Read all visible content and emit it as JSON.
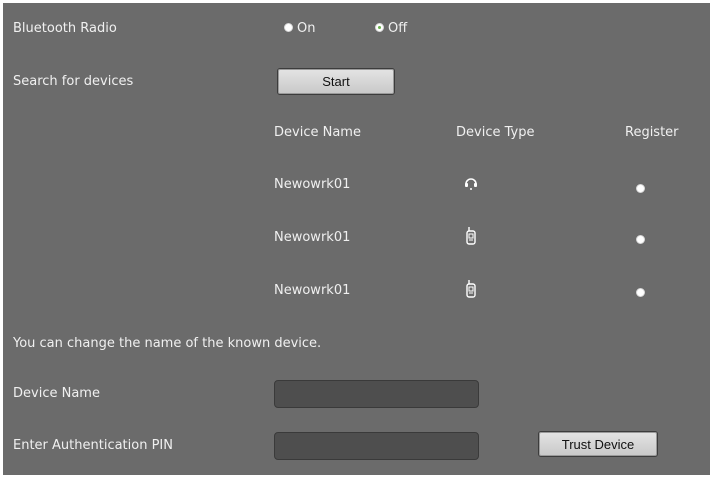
{
  "bluetooth": {
    "label": "Bluetooth Radio",
    "on_label": "On",
    "off_label": "Off",
    "selected": "Off"
  },
  "search": {
    "label": "Search for devices",
    "button": "Start"
  },
  "table": {
    "headers": [
      "Device Name",
      "Device Type",
      "Register"
    ],
    "rows": [
      {
        "name": "Newowrk01",
        "type_icon": "headset-icon"
      },
      {
        "name": "Newowrk01",
        "type_icon": "handset-icon"
      },
      {
        "name": "Newowrk01",
        "type_icon": "handset-icon"
      }
    ]
  },
  "rename_note": "You can change the name of the known device.",
  "device_name": {
    "label": "Device Name",
    "value": ""
  },
  "pin": {
    "label": "Enter Authentication PIN",
    "value": "",
    "button": "Trust Device"
  },
  "colors": {
    "panel_bg": "#6b6b6b",
    "text": "#f0f0f0",
    "input_bg": "#4e4e4e"
  }
}
